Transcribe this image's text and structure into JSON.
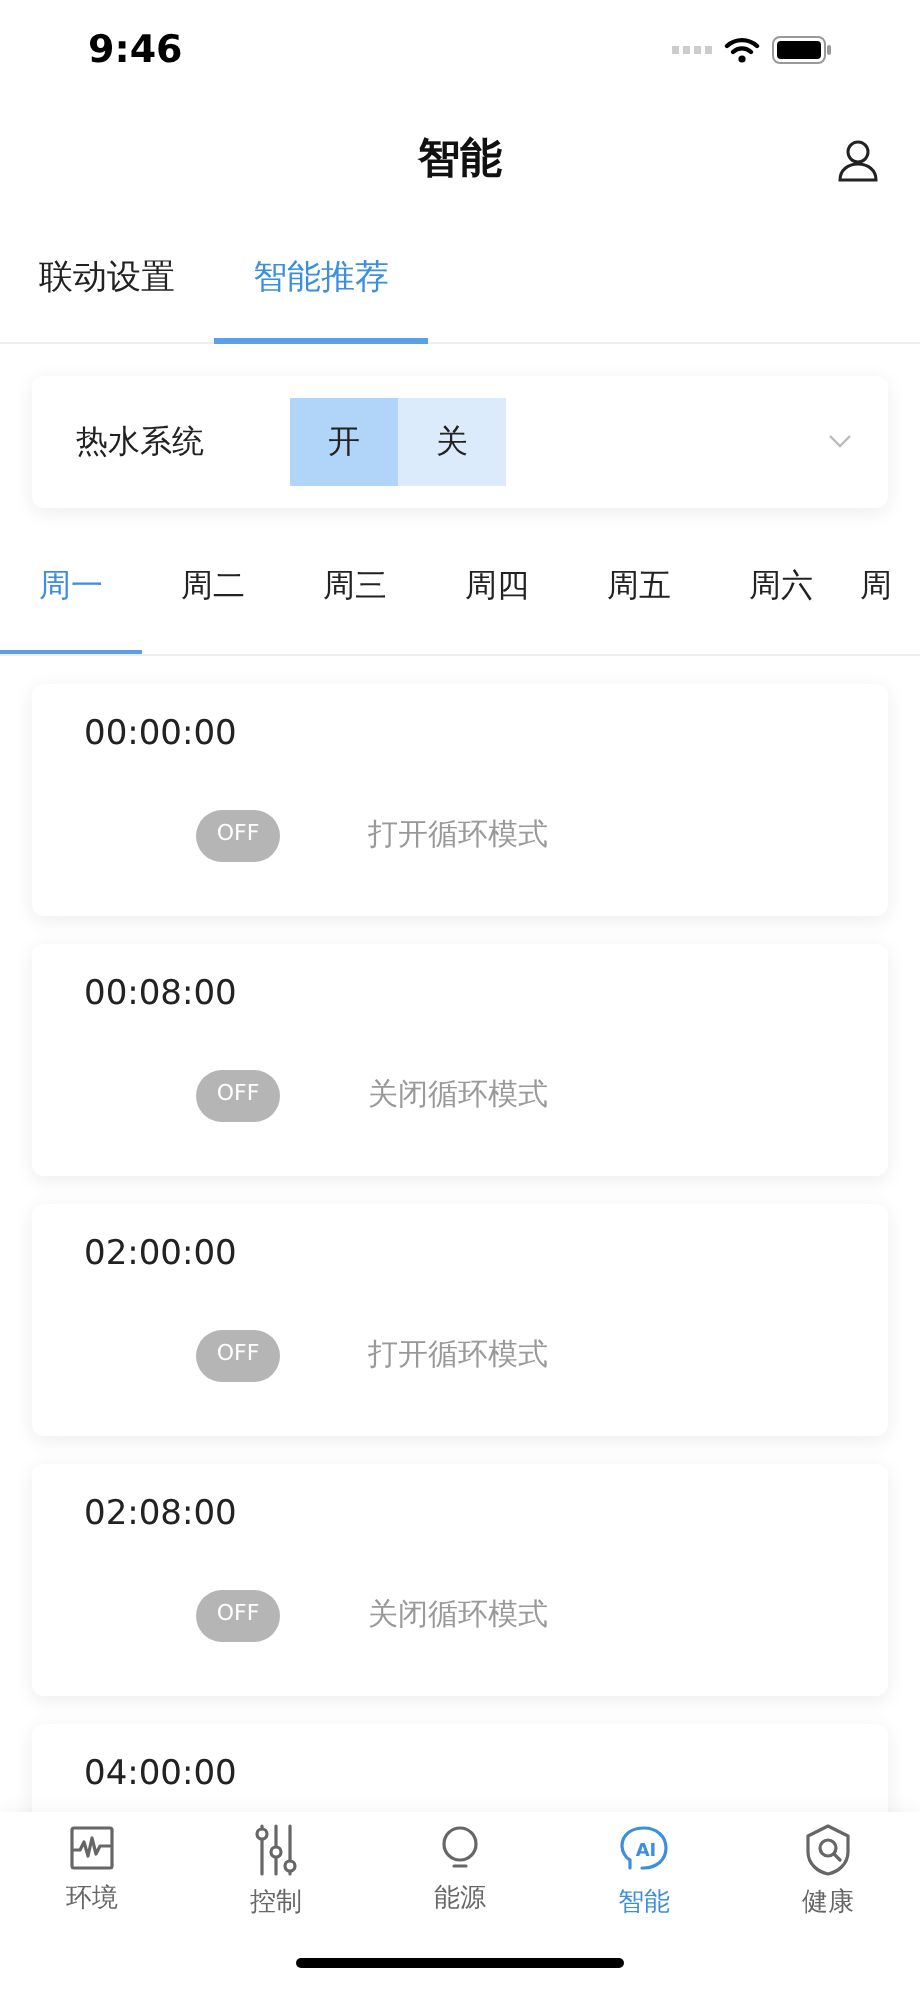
{
  "status_bar": {
    "time": "9:46"
  },
  "header": {
    "title": "智能"
  },
  "tabs": [
    {
      "label": "联动设置",
      "selected": false
    },
    {
      "label": "智能推荐",
      "selected": true
    }
  ],
  "system": {
    "label": "热水系统",
    "options": [
      {
        "label": "开",
        "selected": true
      },
      {
        "label": "关",
        "selected": false
      }
    ]
  },
  "days": [
    {
      "label": "周一",
      "selected": true
    },
    {
      "label": "周二",
      "selected": false
    },
    {
      "label": "周三",
      "selected": false
    },
    {
      "label": "周四",
      "selected": false
    },
    {
      "label": "周五",
      "selected": false
    },
    {
      "label": "周六",
      "selected": false
    },
    {
      "label": "周",
      "selected": false
    }
  ],
  "schedules": [
    {
      "time": "00:00:00",
      "switch": {
        "label": "OFF",
        "on": false
      },
      "action": "打开循环模式"
    },
    {
      "time": "00:08:00",
      "switch": {
        "label": "OFF",
        "on": false
      },
      "action": "关闭循环模式"
    },
    {
      "time": "02:00:00",
      "switch": {
        "label": "OFF",
        "on": false
      },
      "action": "打开循环模式"
    },
    {
      "time": "02:08:00",
      "switch": {
        "label": "OFF",
        "on": false
      },
      "action": "关闭循环模式"
    },
    {
      "time": "04:00:00"
    }
  ],
  "bottom_nav": [
    {
      "label": "环境",
      "kind": "wave",
      "selected": false
    },
    {
      "label": "控制",
      "kind": "sliders",
      "selected": false
    },
    {
      "label": "能源",
      "kind": "bulb",
      "selected": false
    },
    {
      "label": "智能",
      "kind": "ai",
      "icon_text": "AI",
      "selected": true
    },
    {
      "label": "健康",
      "kind": "shield",
      "selected": false
    }
  ]
}
